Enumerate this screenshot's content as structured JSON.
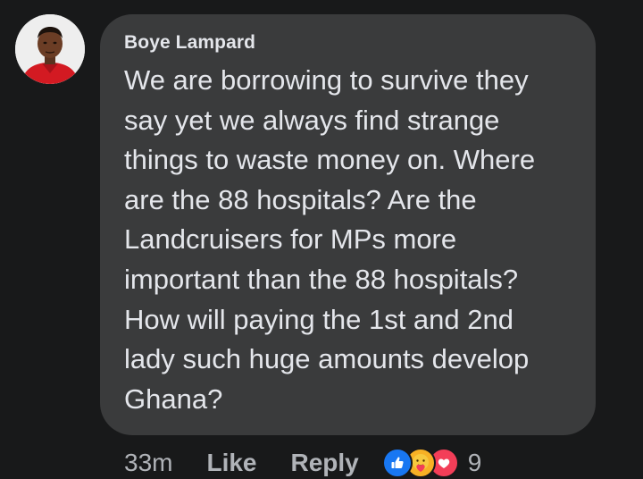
{
  "comment": {
    "author": "Boye Lampard",
    "lines": [
      "We are borrowing to survive they",
      "say yet we always find strange",
      "things to waste money on. Where",
      "are the 88 hospitals? Are the",
      "Landcruisers for MPs more",
      "important than the 88 hospitals?",
      "How will paying the 1st and 2nd",
      "lady such huge amounts develop",
      "Ghana?"
    ]
  },
  "actions": {
    "timestamp": "33m",
    "like_label": "Like",
    "reply_label": "Reply",
    "reaction_count": "9",
    "reactions": [
      "like-icon",
      "care-icon",
      "love-icon"
    ]
  },
  "colors": {
    "background": "#18191a",
    "bubble": "#3a3b3c",
    "text": "#e4e6eb",
    "secondary_text": "#b0b3b8",
    "like": "#1877f2",
    "care": "#f7b125",
    "love": "#f33e58"
  }
}
